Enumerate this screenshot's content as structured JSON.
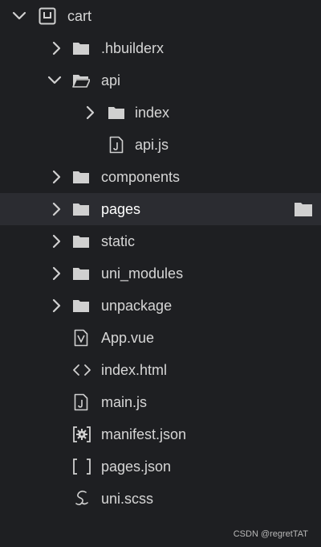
{
  "root": {
    "label": "cart",
    "expanded": true,
    "icon": "project-icon"
  },
  "items": [
    {
      "label": ".hbuilderx",
      "type": "folder",
      "expanded": false
    },
    {
      "label": "api",
      "type": "folder",
      "expanded": true
    },
    {
      "label": "index",
      "type": "folder",
      "expanded": false
    },
    {
      "label": "api.js",
      "type": "js-file"
    },
    {
      "label": "components",
      "type": "folder",
      "expanded": false
    },
    {
      "label": "pages",
      "type": "folder",
      "expanded": false,
      "selected": true
    },
    {
      "label": "static",
      "type": "folder",
      "expanded": false
    },
    {
      "label": "uni_modules",
      "type": "folder",
      "expanded": false
    },
    {
      "label": "unpackage",
      "type": "folder",
      "expanded": false
    },
    {
      "label": "App.vue",
      "type": "vue-file"
    },
    {
      "label": "index.html",
      "type": "html-file"
    },
    {
      "label": "main.js",
      "type": "js-file"
    },
    {
      "label": "manifest.json",
      "type": "manifest-file"
    },
    {
      "label": "pages.json",
      "type": "json-file"
    },
    {
      "label": "uni.scss",
      "type": "scss-file"
    }
  ],
  "colors": {
    "background": "#1e1f22",
    "selected_row": "#2b2c31",
    "text": "#d6d6d6",
    "icon": "#d0d0d0"
  },
  "watermark": "CSDN @regretTAT"
}
